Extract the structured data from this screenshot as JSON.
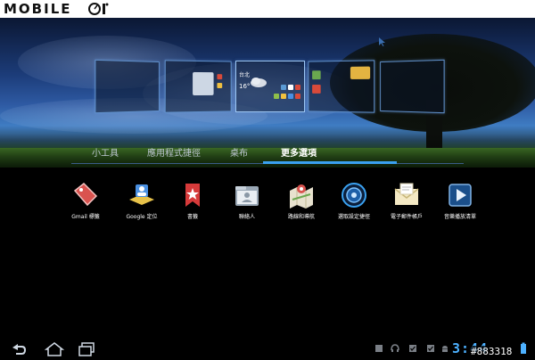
{
  "watermark": {
    "logo_text": "MOBILE",
    "image_id": "#883318"
  },
  "tabs": [
    {
      "label": "小工具"
    },
    {
      "label": "應用程式捷徑"
    },
    {
      "label": "桌布"
    },
    {
      "label": "更多選項",
      "selected": true
    }
  ],
  "widget_preview": {
    "city": "台北",
    "temperature": "16°"
  },
  "apps": [
    {
      "label": "Gmail 標籤",
      "icon": "gmail-label-icon"
    },
    {
      "label": "Google 定位",
      "icon": "google-latitude-icon"
    },
    {
      "label": "書籤",
      "icon": "bookmark-icon"
    },
    {
      "label": "聯絡人",
      "icon": "contacts-icon"
    },
    {
      "label": "路線和導航",
      "icon": "maps-directions-icon"
    },
    {
      "label": "選取設定捷徑",
      "icon": "settings-shortcut-icon"
    },
    {
      "label": "電子郵件帳戶",
      "icon": "email-account-icon"
    },
    {
      "label": "音樂播放清單",
      "icon": "music-playlist-icon"
    }
  ],
  "status_bar": {
    "clock": "3:44"
  },
  "colors": {
    "accent": "#3aa1f0",
    "clock": "#4db1ff",
    "panel_border": "#5f8fc9"
  }
}
